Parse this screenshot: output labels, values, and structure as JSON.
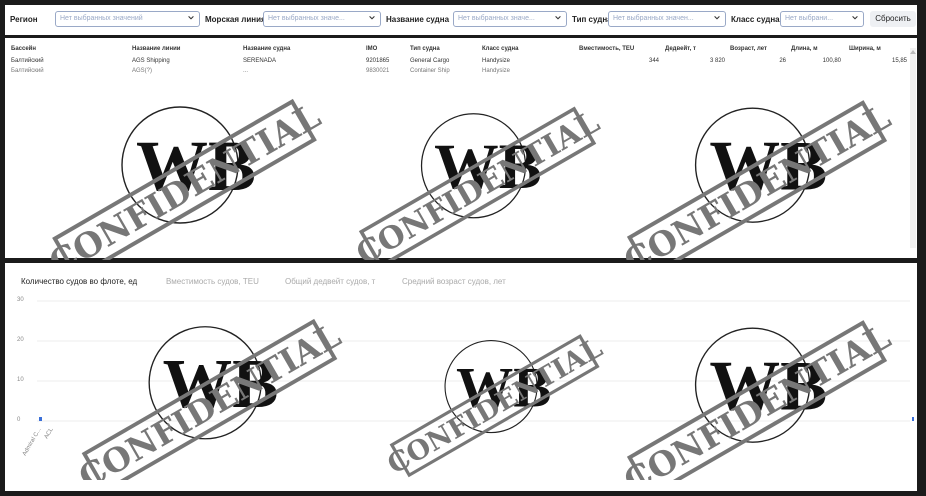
{
  "filters": {
    "region": {
      "label": "Регион",
      "placeholder": "Нет выбранных значений"
    },
    "line": {
      "label": "Морская линия",
      "placeholder": "Нет выбранных значе..."
    },
    "vessel_name": {
      "label": "Название судна",
      "placeholder": "Нет выбранных значе..."
    },
    "vessel_type": {
      "label": "Тип судна",
      "placeholder": "Нет выбранных значен..."
    },
    "vessel_class": {
      "label": "Класс судна",
      "placeholder": "Нет выбрани..."
    },
    "reset_label": "Сбросить"
  },
  "table": {
    "columns": [
      "Бассейн",
      "Название линии",
      "Название судна",
      "IMO",
      "Тип судна",
      "Класс судна",
      "Вместимость, TEU",
      "Дедвейт, т",
      "Возраст, лет",
      "Длина, м",
      "Ширина, м"
    ],
    "rows": [
      [
        "Балтийский",
        "AGS Shipping",
        "SERENADA",
        "9201865",
        "General Cargo",
        "Handysize",
        "344",
        "3 820",
        "26",
        "100,80",
        "15,85"
      ],
      [
        "Балтийский",
        "AGS(?)",
        "...",
        "9830021",
        "Container Ship",
        "Handysize",
        "",
        "",
        "",
        "",
        ""
      ]
    ]
  },
  "chart": {
    "tabs": [
      "Количество судов во флоте, ед",
      "Вместимость судов, TEU",
      "Общий дедвейт судов, т",
      "Средний возраст судов, лет"
    ],
    "active_tab": 0
  },
  "chart_data": {
    "type": "bar",
    "title": "Количество судов во флоте, ед",
    "ylim": [
      0,
      30
    ],
    "yticks": [
      "30",
      "20",
      "10",
      "0"
    ],
    "categories": [
      "Admiral C...",
      "ACL"
    ],
    "values": [
      1,
      0
    ]
  },
  "watermark": {
    "text": "CONFIDENTIAL",
    "logo": "WB"
  },
  "colors": {
    "placeholder": "#9aa9c7",
    "panel": "#ffffff",
    "background": "#1b1b1b",
    "bar": "#3a6fd8"
  }
}
